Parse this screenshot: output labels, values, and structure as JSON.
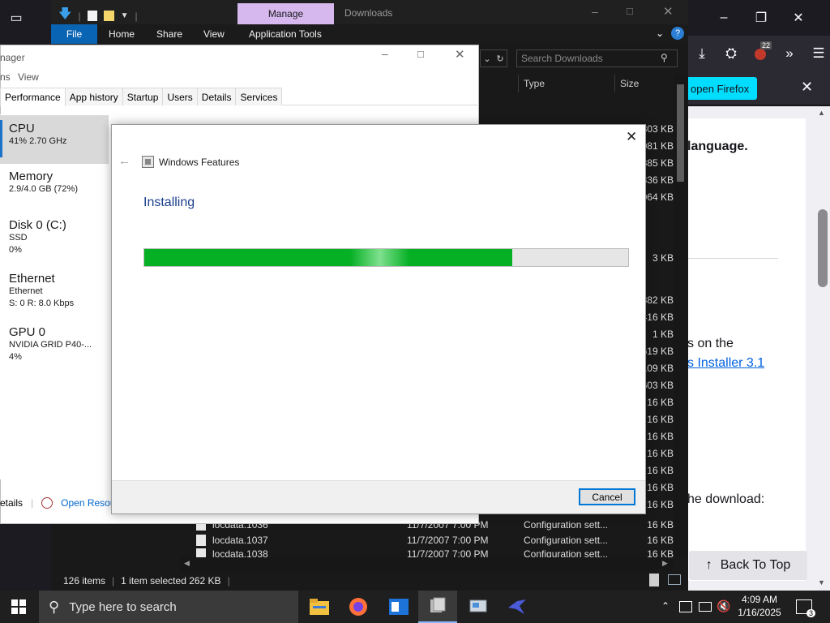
{
  "firefox": {
    "notice_button": "open Firefox",
    "tab_count": "22",
    "article_lines": [
      "language.",
      "s on the",
      "s Installer 3.1",
      "he download:"
    ],
    "back_to_top": "Back To Top"
  },
  "explorer": {
    "manage_label": "Manage",
    "title": "Downloads",
    "ribbon_tabs": [
      "File",
      "Home",
      "Share",
      "View",
      "Application Tools"
    ],
    "search_placeholder": "Search Downloads",
    "col_type": "Type",
    "col_size": "Size",
    "sizes": [
      "803 KB",
      "081 KB",
      "385 KB",
      "336 KB",
      "064 KB",
      "3 KB",
      "882 KB",
      "416 KB",
      "1 KB",
      "619 KB",
      "109 KB",
      "603 KB",
      "16 KB",
      "16 KB",
      "16 KB",
      "16 KB",
      "16 KB",
      "16 KB",
      "16 KB",
      "16 KB",
      "16 KB",
      "16 KB"
    ],
    "rows": [
      {
        "name": "locdata.1036",
        "date": "11/7/2007 7:00 PM",
        "type": "Configuration sett...",
        "size": "16 KB"
      },
      {
        "name": "locdata.1037",
        "date": "11/7/2007 7:00 PM",
        "type": "Configuration sett...",
        "size": "16 KB"
      },
      {
        "name": "locdata.1038",
        "date": "11/7/2007 7:00 PM",
        "type": "Configuration sett...",
        "size": "16 KB"
      }
    ],
    "status_items": "126 items",
    "status_selected": "1 item selected  262 KB"
  },
  "taskmgr": {
    "title": "nager",
    "menu": [
      "ns",
      "View"
    ],
    "tabs": [
      "Performance",
      "App history",
      "Startup",
      "Users",
      "Details",
      "Services"
    ],
    "items": [
      {
        "name": "CPU",
        "l1": "41%  2.70 GHz",
        "l2": ""
      },
      {
        "name": "Memory",
        "l1": "2.9/4.0 GB (72%)",
        "l2": ""
      },
      {
        "name": "Disk 0 (C:)",
        "l1": "SSD",
        "l2": "0%"
      },
      {
        "name": "Ethernet",
        "l1": "Ethernet",
        "l2": "S: 0  R: 8.0 Kbps"
      },
      {
        "name": "GPU 0",
        "l1": "NVIDIA GRID P40-...",
        "l2": "4%"
      }
    ],
    "fewer_details": "etails",
    "open_resource": "Open Resource"
  },
  "dialog": {
    "title": "Windows Features",
    "heading": "Installing",
    "progress": 0.76,
    "cancel": "Cancel"
  },
  "taskbar": {
    "search_placeholder": "Type here to search",
    "time": "4:09 AM",
    "date": "1/16/2025",
    "notification_count": "3"
  },
  "icons": [
    "windows-logo-icon",
    "search-icon",
    "file-explorer-icon",
    "firefox-icon",
    "app-icon",
    "windows-features-icon",
    "control-panel-icon",
    "bird-icon",
    "chevron-up-icon",
    "network-icon",
    "volume-muted-icon",
    "notification-icon"
  ]
}
